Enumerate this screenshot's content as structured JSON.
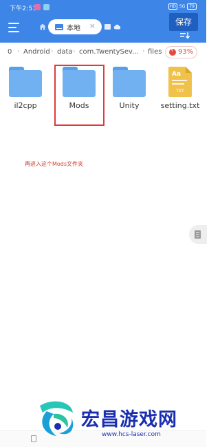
{
  "status_bar": {
    "time": "下午2:51",
    "hd_badge": "HD",
    "signal": "5G",
    "battery": "79"
  },
  "header": {
    "tab_label": "本地",
    "save_label": "保存"
  },
  "breadcrumb": {
    "items": [
      "0",
      "Android",
      "data",
      "com.TwentySev...",
      "files"
    ],
    "storage_percent": "93%"
  },
  "files": [
    {
      "name": "il2cpp",
      "type": "folder"
    },
    {
      "name": "Mods",
      "type": "folder"
    },
    {
      "name": "Unity",
      "type": "folder"
    },
    {
      "name": "setting.txt",
      "type": "txt",
      "icon_text": "Aa",
      "icon_kind": "TXT"
    }
  ],
  "annotation": "再进入这个Mods文件夹",
  "watermark": {
    "title": "宏昌游戏网",
    "url": "www.hcs-laser.com"
  },
  "colors": {
    "header": "#3d86e8",
    "save_button": "#1f5fbf",
    "folder": "#72b1f1",
    "txt_file": "#f0c24b",
    "highlight": "#e03a3a",
    "watermark": "#1a2fb0"
  }
}
